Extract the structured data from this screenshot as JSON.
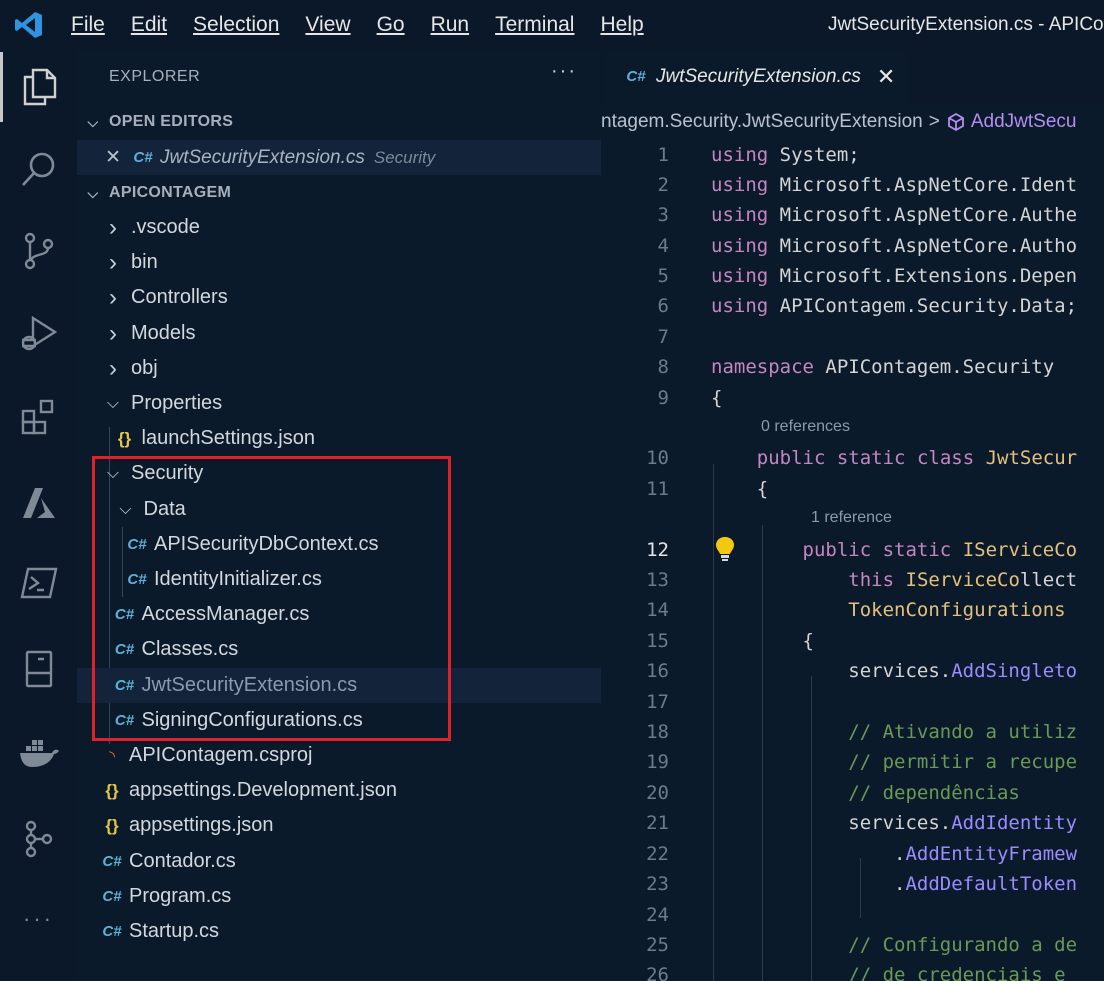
{
  "menu": [
    "File",
    "Edit",
    "Selection",
    "View",
    "Go",
    "Run",
    "Terminal",
    "Help"
  ],
  "window_title": "JwtSecurityExtension.cs - APICon",
  "sidebar": {
    "title": "EXPLORER",
    "more": "···",
    "open_editors_label": "OPEN EDITORS",
    "open_editor": {
      "name": "JwtSecurityExtension.cs",
      "folder": "Security"
    },
    "project_label": "APICONTAGEM",
    "tree": [
      {
        "label": ".vscode",
        "kind": "folder",
        "expanded": false
      },
      {
        "label": "bin",
        "kind": "folder",
        "expanded": false
      },
      {
        "label": "Controllers",
        "kind": "folder",
        "expanded": false
      },
      {
        "label": "Models",
        "kind": "folder",
        "expanded": false
      },
      {
        "label": "obj",
        "kind": "folder",
        "expanded": false
      },
      {
        "label": "Properties",
        "kind": "folder",
        "expanded": true
      },
      {
        "label": "launchSettings.json",
        "kind": "json"
      },
      {
        "label": "Security",
        "kind": "folder",
        "expanded": true
      },
      {
        "label": "Data",
        "kind": "folder",
        "expanded": true
      },
      {
        "label": "APISecurityDbContext.cs",
        "kind": "cs"
      },
      {
        "label": "IdentityInitializer.cs",
        "kind": "cs"
      },
      {
        "label": "AccessManager.cs",
        "kind": "cs"
      },
      {
        "label": "Classes.cs",
        "kind": "cs"
      },
      {
        "label": "JwtSecurityExtension.cs",
        "kind": "cs",
        "selected": true
      },
      {
        "label": "SigningConfigurations.cs",
        "kind": "cs"
      },
      {
        "label": "APIContagem.csproj",
        "kind": "rss"
      },
      {
        "label": "appsettings.Development.json",
        "kind": "json"
      },
      {
        "label": "appsettings.json",
        "kind": "json"
      },
      {
        "label": "Contador.cs",
        "kind": "cs"
      },
      {
        "label": "Program.cs",
        "kind": "cs"
      },
      {
        "label": "Startup.cs",
        "kind": "cs"
      }
    ]
  },
  "editor": {
    "tab_label": "JwtSecurityExtension.cs",
    "tab_close": "✕",
    "breadcrumb_ns": "ntagem.Security.JwtSecurityExtension",
    "breadcrumb_sep": ">",
    "breadcrumb_method": "AddJwtSecu",
    "codelens": [
      "0 references",
      "1 reference"
    ],
    "lines": [
      {
        "n": "1",
        "t": "using System;"
      },
      {
        "n": "2",
        "t": "using Microsoft.AspNetCore.Ident"
      },
      {
        "n": "3",
        "t": "using Microsoft.AspNetCore.Authe"
      },
      {
        "n": "4",
        "t": "using Microsoft.AspNetCore.Autho"
      },
      {
        "n": "5",
        "t": "using Microsoft.Extensions.Depen"
      },
      {
        "n": "6",
        "t": "using APIContagem.Security.Data;"
      },
      {
        "n": "7",
        "t": ""
      },
      {
        "n": "8",
        "t": "namespace APIContagem.Security"
      },
      {
        "n": "9",
        "t": "{"
      },
      {
        "n": "10",
        "t": "    public static class JwtSecur"
      },
      {
        "n": "11",
        "t": "    {"
      },
      {
        "n": "12",
        "t": "        public static IServiceCo"
      },
      {
        "n": "13",
        "t": "            this IServiceCollect"
      },
      {
        "n": "14",
        "t": "            TokenConfigurations"
      },
      {
        "n": "15",
        "t": "        {"
      },
      {
        "n": "16",
        "t": "            services.AddSingleto"
      },
      {
        "n": "17",
        "t": ""
      },
      {
        "n": "18",
        "t": "            // Ativando a utiliz"
      },
      {
        "n": "19",
        "t": "            // permitir a recupe"
      },
      {
        "n": "20",
        "t": "            // dependências"
      },
      {
        "n": "21",
        "t": "            services.AddIdentity"
      },
      {
        "n": "22",
        "t": "                .AddEntityFramew"
      },
      {
        "n": "23",
        "t": "                .AddDefaultToken"
      },
      {
        "n": "24",
        "t": ""
      },
      {
        "n": "25",
        "t": "            // Configurando a de"
      },
      {
        "n": "26",
        "t": "            // de credenciais e"
      }
    ]
  }
}
